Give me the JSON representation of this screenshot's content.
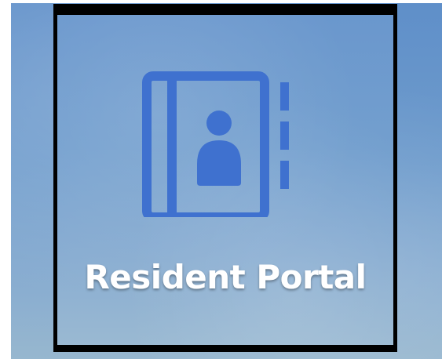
{
  "tile": {
    "label": "Resident Portal",
    "icon": "address-book-icon"
  },
  "colors": {
    "icon": "#3f71cf",
    "label": "#ffffff",
    "frame": "#000000"
  }
}
